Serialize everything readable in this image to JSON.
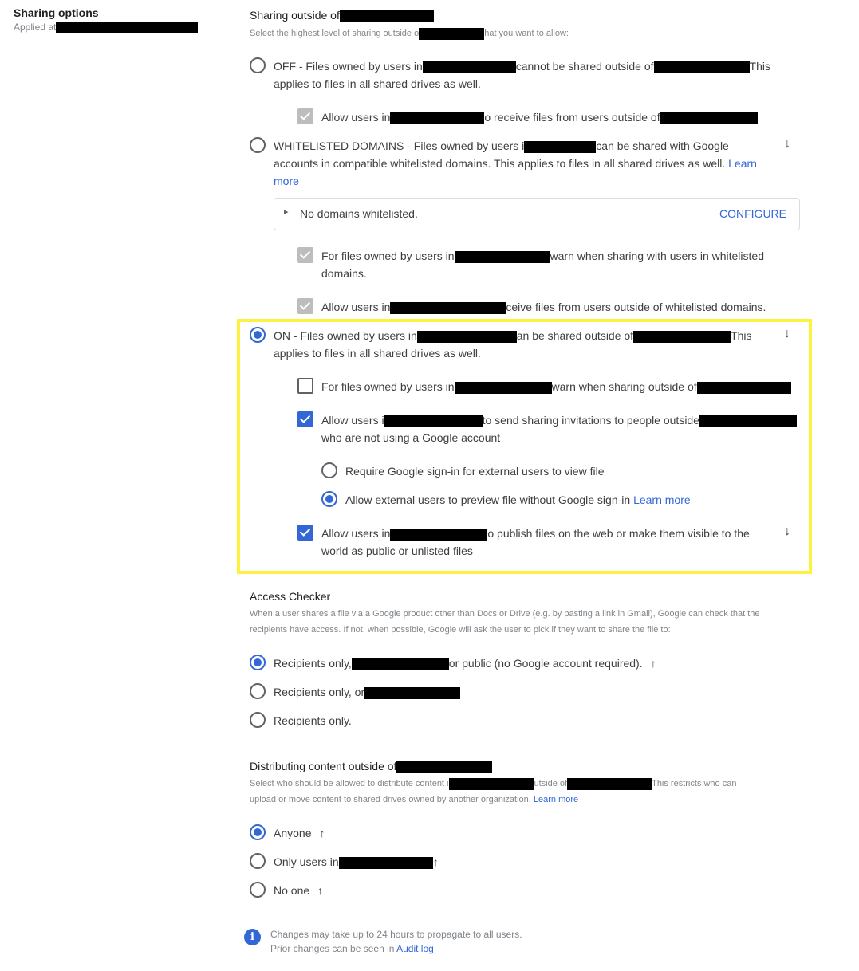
{
  "left": {
    "title": "Sharing options",
    "applied_at_label": "Applied at"
  },
  "sharing_outside": {
    "title": "Sharing outside of",
    "desc_prefix": "Select the highest level of sharing outside o",
    "desc_suffix": "hat you want to allow:",
    "options": {
      "off": {
        "selected": false,
        "part1": "OFF - Files owned by users in",
        "part2": "cannot be shared outside of",
        "part3": "This",
        "line2": "applies to files in all shared drives as well.",
        "sub_checkbox": {
          "checked": true,
          "disabled": true,
          "part1": "Allow users in",
          "part2": "o receive files from users outside of"
        }
      },
      "whitelisted": {
        "selected": false,
        "part1": "WHITELISTED DOMAINS - Files owned by users i",
        "part2": "can be shared with Google",
        "line2": "accounts in compatible whitelisted domains. This applies to files in all shared drives as well.",
        "learn": "Learn",
        "more": "more",
        "domains_box": {
          "text": "No domains whitelisted.",
          "configure": "CONFIGURE"
        },
        "warn_checkbox": {
          "checked": true,
          "disabled": true,
          "part1": "For files owned by users in",
          "part2": "warn when sharing with users in whitelisted",
          "line2": "domains."
        },
        "receive_checkbox": {
          "checked": true,
          "disabled": true,
          "part1": "Allow users in",
          "part2": "ceive files from users outside of whitelisted domains."
        }
      },
      "on": {
        "selected": true,
        "part1": "ON - Files owned by users in",
        "part2": "an be shared outside of",
        "part3": "This",
        "line2": "applies to files in all shared drives as well.",
        "warn_checkbox": {
          "checked": false,
          "part1": "For files owned by users in",
          "part2": "warn when sharing outside of"
        },
        "invite_checkbox": {
          "checked": true,
          "part1": "Allow users i",
          "part2": "to send sharing invitations to people outside",
          "line2": "who are not using a Google account",
          "sub_radios": [
            {
              "label": "Require Google sign-in for external users to view file",
              "selected": false
            },
            {
              "label": "Allow external users to preview file without Google sign-in",
              "learn_more": "Learn more",
              "selected": true
            }
          ]
        },
        "publish_checkbox": {
          "checked": true,
          "part1": "Allow users in",
          "part2": "o publish files on the web or make them visible to the",
          "line2": "world as public or unlisted files"
        }
      }
    }
  },
  "access_checker": {
    "title": "Access Checker",
    "desc_line1": "When a user shares a file via a Google product other than Docs or Drive (e.g. by pasting a link in Gmail), Google can check that the",
    "desc_line2": "recipients have access. If not, when possible, Google will ask the user to pick if they want to share the file to:",
    "options": [
      {
        "part1": "Recipients only,",
        "part2": "or public (no Google account required).",
        "selected": true
      },
      {
        "part1": "Recipients only, or",
        "selected": false
      },
      {
        "part1": "Recipients only.",
        "selected": false
      }
    ]
  },
  "distributing": {
    "title": "Distributing content outside of",
    "desc_part1": "Select who should be allowed to distribute content i",
    "desc_part2": "utside of",
    "desc_part3": "This restricts who can",
    "desc_line2": "upload or move content to shared drives owned by another organization.",
    "learn_more": "Learn more",
    "options": [
      {
        "label": "Anyone",
        "selected": true
      },
      {
        "label": "Only users in",
        "selected": false
      },
      {
        "label": "No one",
        "selected": false
      }
    ]
  },
  "footer": {
    "line1": "Changes may take up to 24 hours to propagate to all users.",
    "line2_prefix": "Prior changes can be seen in",
    "audit_log": "Audit log"
  },
  "icons": {
    "arrow_down": "↓",
    "arrow_up": "↑",
    "info": "i",
    "expand": "▸"
  },
  "colors": {
    "accent": "#3367d6",
    "highlight": "#fff23f"
  }
}
